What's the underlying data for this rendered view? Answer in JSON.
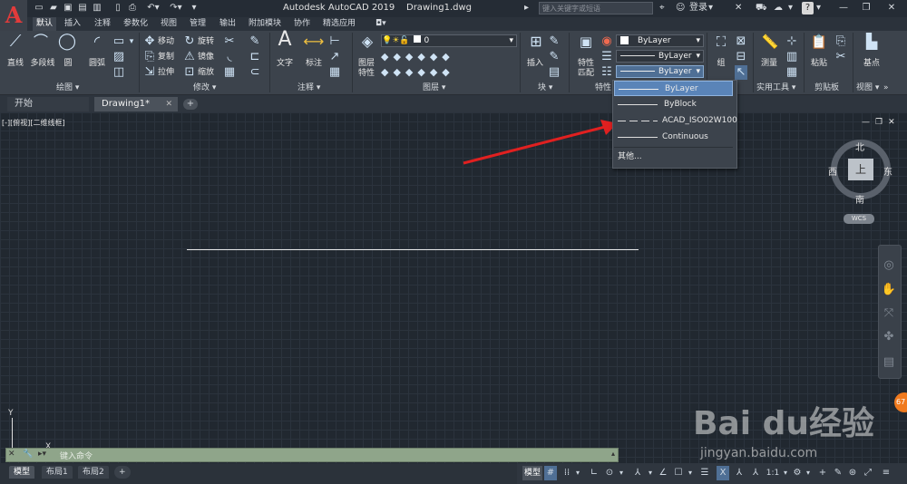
{
  "app": {
    "title": "Autodesk AutoCAD 2019",
    "document": "Drawing1.dwg",
    "logo_letter": "A",
    "search_placeholder": "键入关键字或短语",
    "login_label": "登录"
  },
  "ribbon_tabs": [
    "默认",
    "插入",
    "注释",
    "参数化",
    "视图",
    "管理",
    "输出",
    "附加模块",
    "协作",
    "精选应用"
  ],
  "panels": {
    "draw": {
      "label": "绘图 ▾",
      "line": "直线",
      "polyline": "多段线",
      "circle": "圆",
      "arc": "圆弧"
    },
    "modify": {
      "label": "修改 ▾",
      "move": "移动",
      "rotate": "旋转",
      "copy": "复制",
      "mirror": "镜像",
      "stretch": "拉伸",
      "scale": "缩放"
    },
    "annotation": {
      "label": "注释 ▾",
      "text": "文字",
      "dimension": "标注"
    },
    "layers": {
      "label": "图层 ▾",
      "props_line1": "图层",
      "props_line2": "特性",
      "current_layer": "0"
    },
    "block": {
      "label": "块 ▾",
      "insert": "插入"
    },
    "properties": {
      "label": "特性 ▾",
      "match_line1": "特性",
      "match_line2": "匹配",
      "color": "ByLayer",
      "lineweight": "ByLayer",
      "linetype": "ByLayer"
    },
    "groups": {
      "label": "组 ▾",
      "group": "组"
    },
    "utilities": {
      "label": "实用工具 ▾",
      "measure": "测量"
    },
    "clipboard": {
      "label": "剪贴板",
      "paste": "粘贴"
    },
    "view": {
      "label": "视图 ▾",
      "base": "基点"
    }
  },
  "file_tabs": {
    "start": "开始",
    "drawing": "Drawing1*"
  },
  "viewport_label": "[-][俯视][二维线框]",
  "linetype_dropdown": {
    "items": [
      "ByLayer",
      "ByBlock",
      "ACAD_ISO02W100",
      "Continuous"
    ],
    "selected": "ByLayer",
    "other": "其他..."
  },
  "viewcube": {
    "north": "北",
    "south": "南",
    "east": "东",
    "west": "西",
    "top": "上",
    "wcs": "WCS"
  },
  "command_placeholder": "键入命令",
  "layout_tabs": [
    "模型",
    "布局1",
    "布局2"
  ],
  "status": {
    "model": "模型",
    "scale": "1:1"
  },
  "ucs": {
    "y": "Y",
    "x": "X"
  },
  "watermark": {
    "brand": "Bai du经验",
    "url": "jingyan.baidu.com"
  },
  "badge": "67",
  "colors": {
    "arrow": "#e02020",
    "highlight": "#5a84b8",
    "command_bg": "#8fa58a"
  }
}
